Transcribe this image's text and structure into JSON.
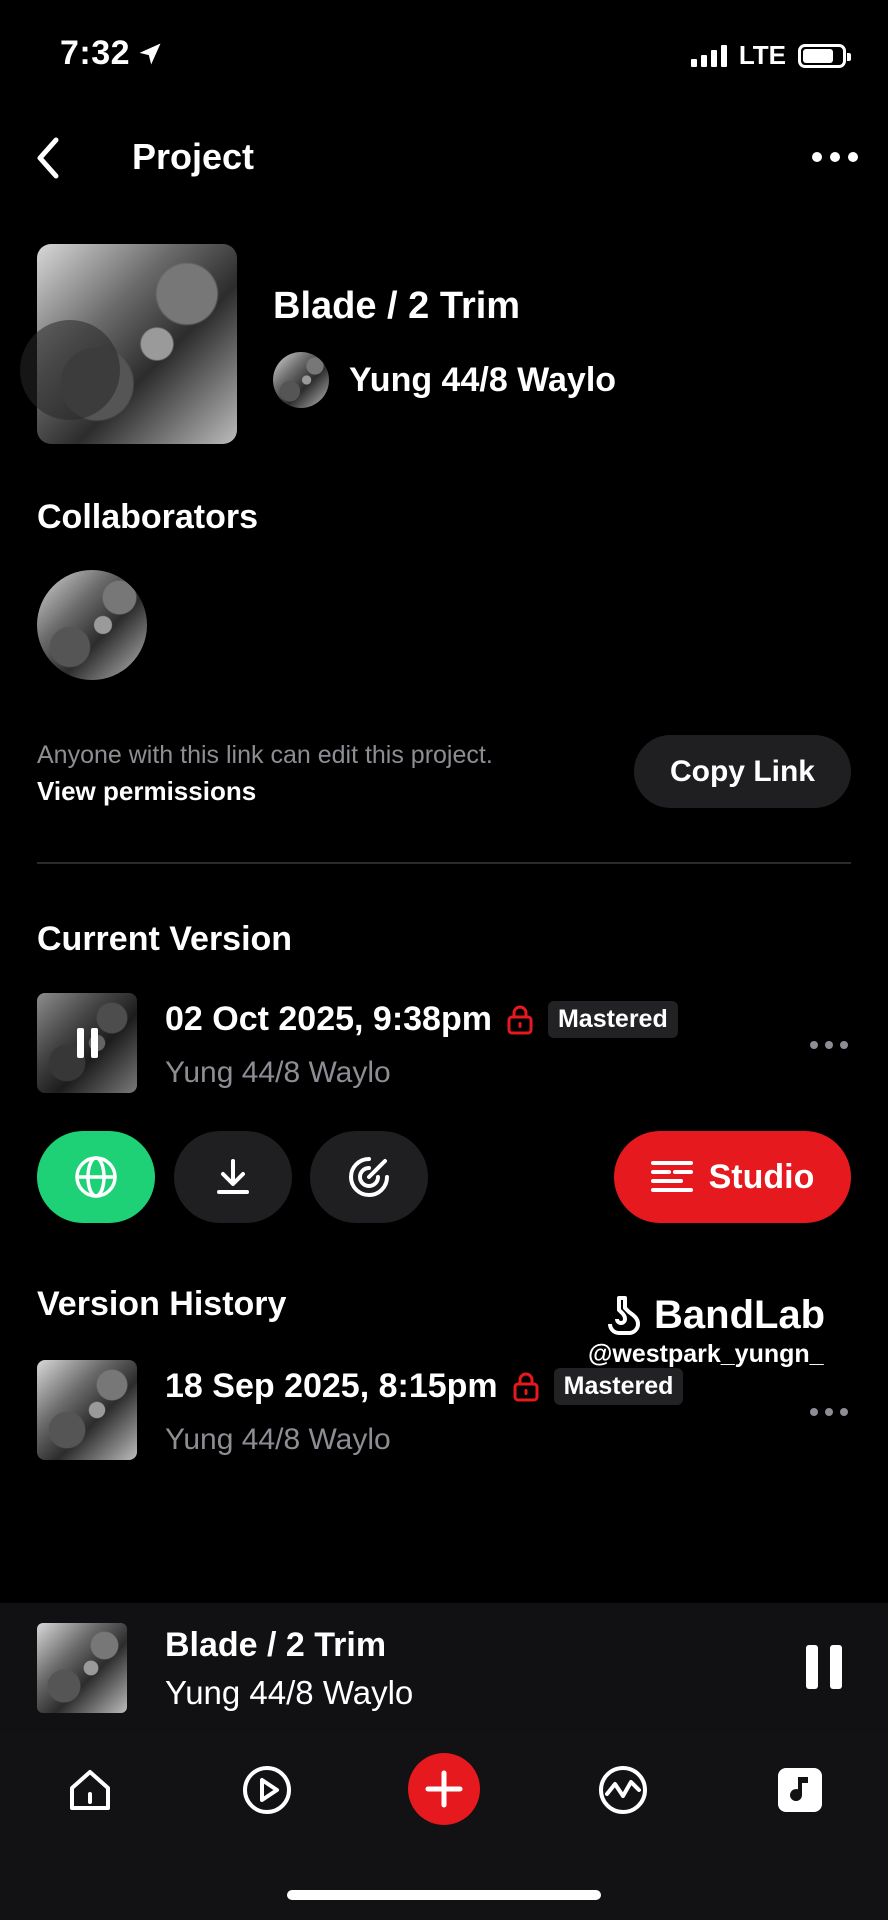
{
  "status_bar": {
    "time": "7:32",
    "network": "LTE"
  },
  "header": {
    "title": "Project"
  },
  "project": {
    "title": "Blade / 2 Trim",
    "owner": "Yung 44/8 Waylo"
  },
  "collaborators": {
    "title": "Collaborators",
    "link_note": "Anyone with this link can edit this project.",
    "permissions_label": "View permissions",
    "copy_link_label": "Copy Link"
  },
  "current_version": {
    "title": "Current Version",
    "date": "02 Oct 2025, 9:38pm",
    "badge": "Mastered",
    "artist": "Yung 44/8 Waylo"
  },
  "actions": {
    "studio_label": "Studio"
  },
  "version_history": {
    "title": "Version History",
    "items": [
      {
        "date": "18 Sep 2025, 8:15pm",
        "badge": "Mastered",
        "artist": "Yung 44/8 Waylo"
      }
    ]
  },
  "watermark": {
    "brand": "BandLab",
    "handle": "@westpark_yungn_"
  },
  "mini_player": {
    "title": "Blade / 2 Trim",
    "artist": "Yung 44/8 Waylo"
  },
  "colors": {
    "accent_red": "#e6191e",
    "accent_green": "#1ed177",
    "muted_text": "#8d8d93"
  },
  "tabs": [
    "home-icon",
    "feed-play-icon",
    "create-plus-icon",
    "explore-icon",
    "library-icon"
  ]
}
